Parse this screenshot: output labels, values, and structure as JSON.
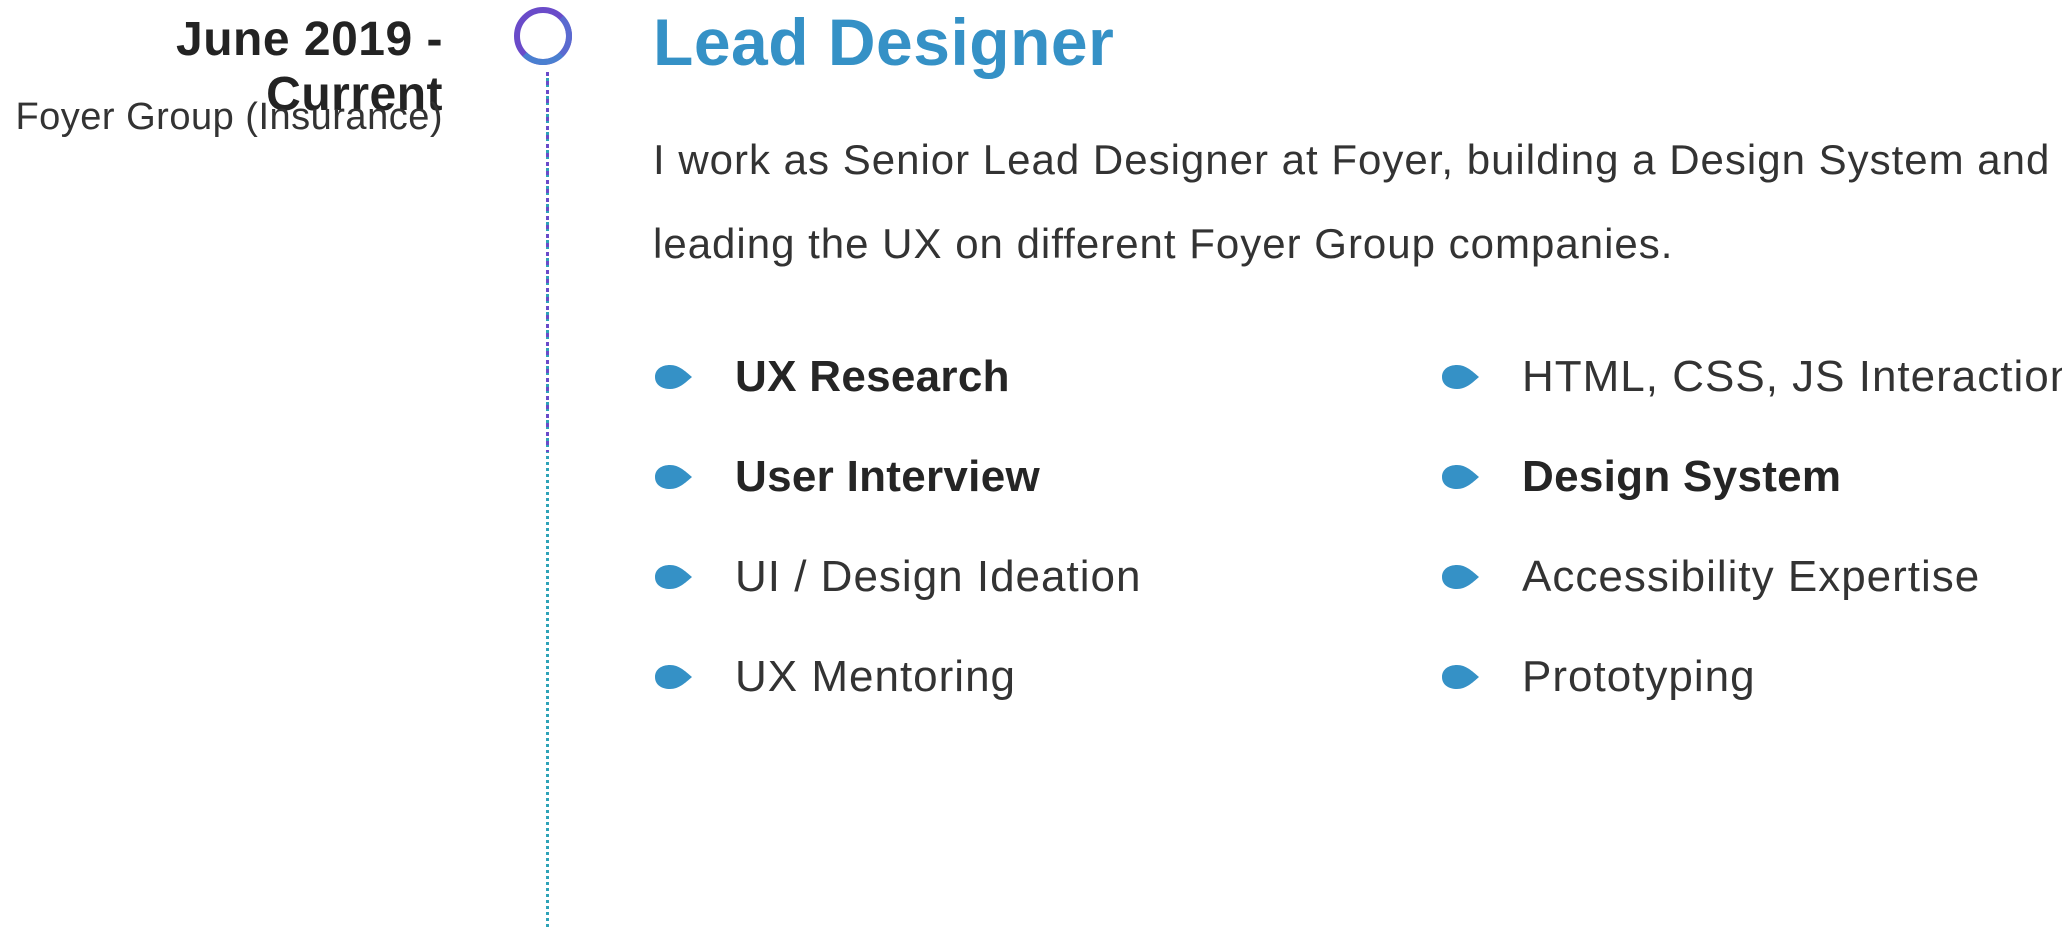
{
  "experience": {
    "period": "June 2019 - Current",
    "company": "Foyer Group (Insurance)",
    "title": "Lead Designer",
    "summary": "I work as Senior Lead Designer at Foyer, building a Design System and leading the UX on different Foyer Group companies.",
    "skills": [
      {
        "label": "UX Research",
        "bold": true
      },
      {
        "label": "HTML, CSS, JS Interaction",
        "bold": false
      },
      {
        "label": "User Interview",
        "bold": true
      },
      {
        "label": "Design System",
        "bold": true
      },
      {
        "label": "UI / Design Ideation",
        "bold": false
      },
      {
        "label": "Accessibility Expertise",
        "bold": false
      },
      {
        "label": "UX Mentoring",
        "bold": false
      },
      {
        "label": "Prototyping",
        "bold": false
      }
    ]
  },
  "colors": {
    "accent": "#3591c6",
    "timeline_top": "#6a4bc9",
    "timeline_bottom": "#2ea3b8",
    "text": "#333333"
  },
  "icons": {
    "bullet": "teardrop-bullet-icon",
    "node": "timeline-circle-icon"
  }
}
